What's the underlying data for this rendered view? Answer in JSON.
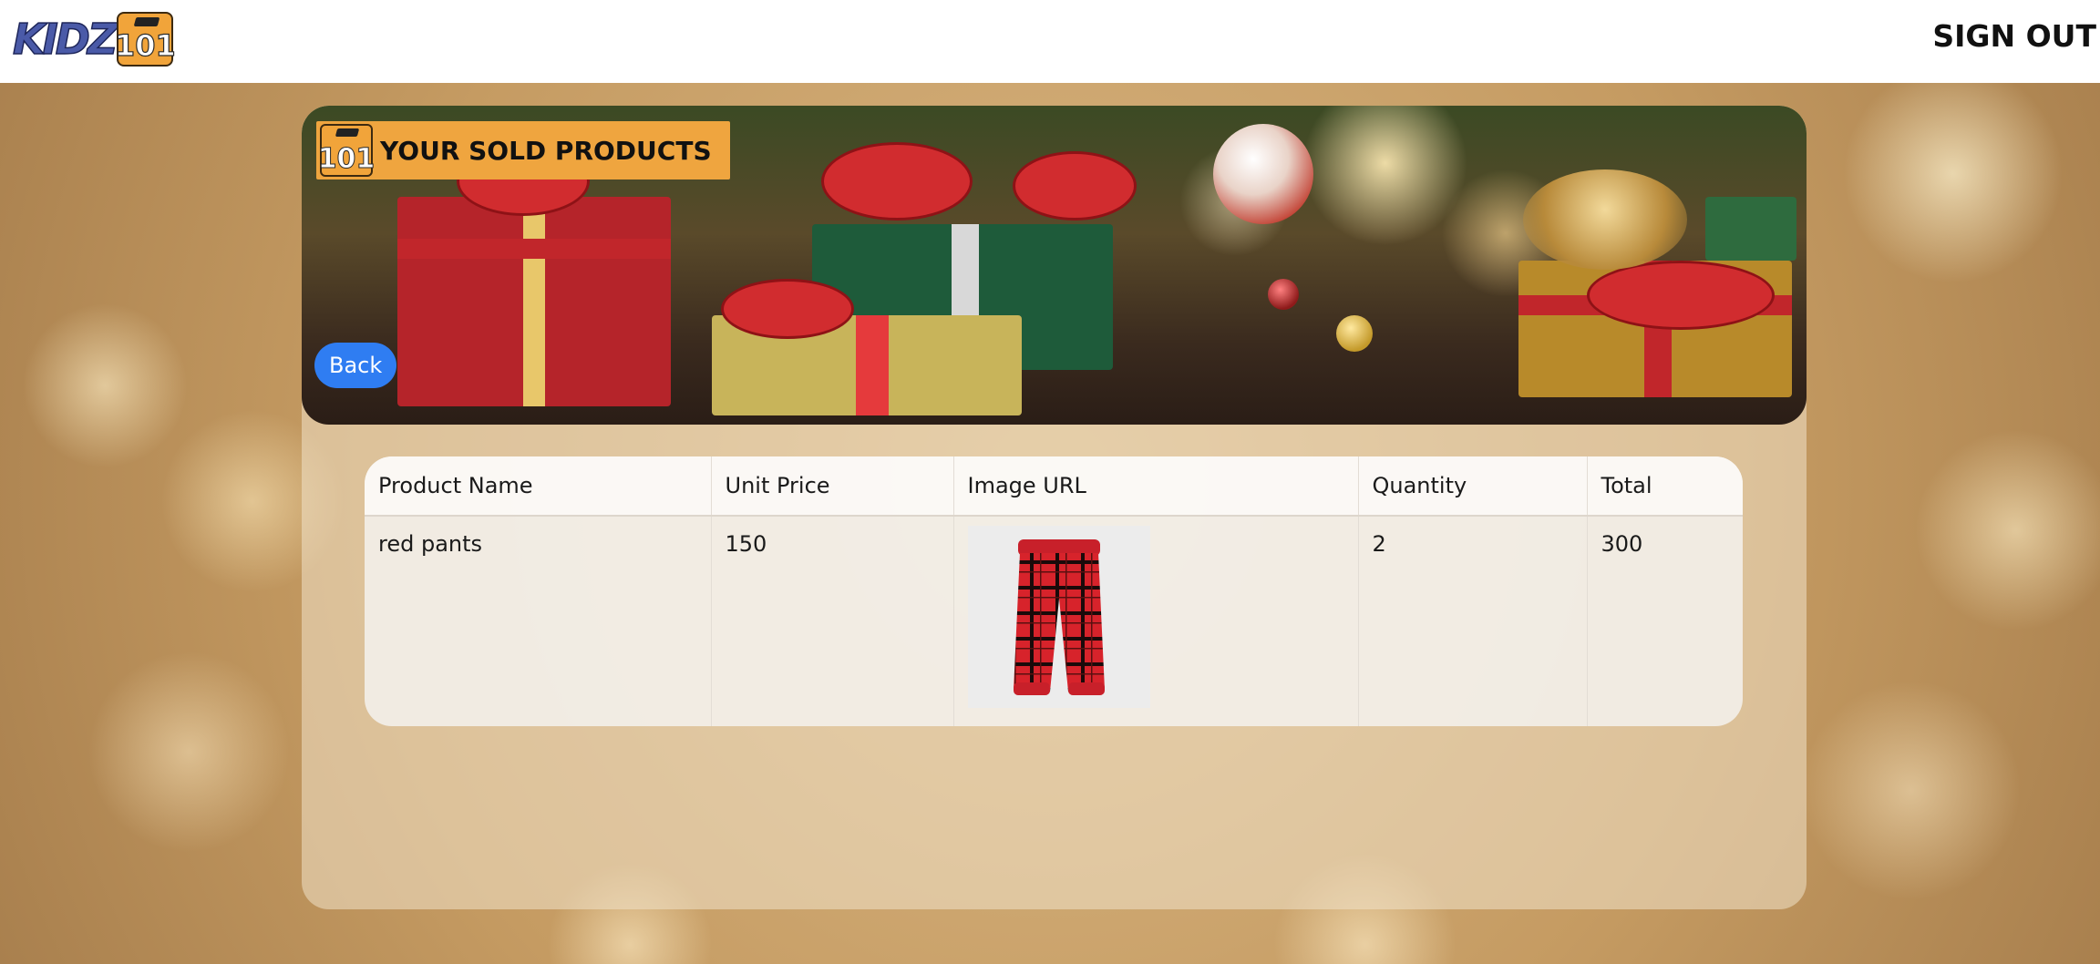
{
  "header": {
    "logo_text": "KIDZ",
    "logo_badge": "101",
    "signout_label": "SIGN OUT"
  },
  "banner": {
    "title": "YOUR SOLD PRODUCTS",
    "badge_text": "101",
    "back_label": "Back"
  },
  "table": {
    "columns": [
      "Product Name",
      "Unit Price",
      "Image URL",
      "Quantity",
      "Total"
    ],
    "rows": [
      {
        "product_name": "red pants",
        "unit_price": "150",
        "image": "red-plaid-pants-image",
        "quantity": "2",
        "total": "300"
      }
    ]
  },
  "colors": {
    "accent_orange": "#efa53f",
    "back_button": "#2f7df2",
    "logo_blue": "#4a5aa8"
  }
}
